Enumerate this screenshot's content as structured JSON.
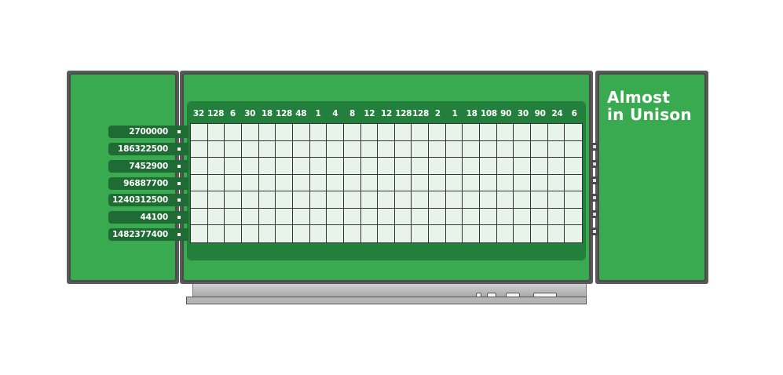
{
  "title_lines": [
    "Almost",
    "in Unison"
  ],
  "column_clues": [
    "32",
    "128",
    "6",
    "30",
    "18",
    "128",
    "48",
    "1",
    "4",
    "8",
    "12",
    "12",
    "128",
    "128",
    "2",
    "1",
    "18",
    "108",
    "90",
    "30",
    "90",
    "24",
    "6"
  ],
  "row_clues": [
    "2700000",
    "186322500",
    "7452900",
    "96887700",
    "1240312500",
    "44100",
    "1482377400"
  ],
  "grid": {
    "rows": 7,
    "cols": 23
  },
  "colors": {
    "board_green": "#3aaa50",
    "dark_green": "#23803c",
    "clue_green": "#1f6b34",
    "cell_fill": "#e8f4ea",
    "frame": "#4a4a4a"
  }
}
